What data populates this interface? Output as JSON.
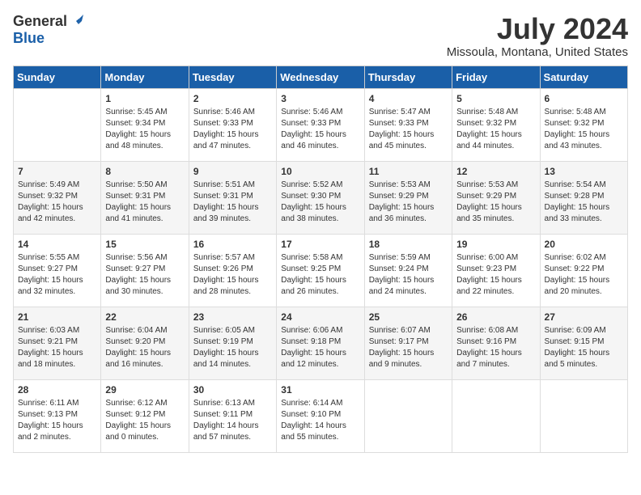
{
  "header": {
    "logo_general": "General",
    "logo_blue": "Blue",
    "title": "July 2024",
    "subtitle": "Missoula, Montana, United States"
  },
  "calendar": {
    "days_of_week": [
      "Sunday",
      "Monday",
      "Tuesday",
      "Wednesday",
      "Thursday",
      "Friday",
      "Saturday"
    ],
    "weeks": [
      [
        {
          "day": "",
          "info": ""
        },
        {
          "day": "1",
          "info": "Sunrise: 5:45 AM\nSunset: 9:34 PM\nDaylight: 15 hours\nand 48 minutes."
        },
        {
          "day": "2",
          "info": "Sunrise: 5:46 AM\nSunset: 9:33 PM\nDaylight: 15 hours\nand 47 minutes."
        },
        {
          "day": "3",
          "info": "Sunrise: 5:46 AM\nSunset: 9:33 PM\nDaylight: 15 hours\nand 46 minutes."
        },
        {
          "day": "4",
          "info": "Sunrise: 5:47 AM\nSunset: 9:33 PM\nDaylight: 15 hours\nand 45 minutes."
        },
        {
          "day": "5",
          "info": "Sunrise: 5:48 AM\nSunset: 9:32 PM\nDaylight: 15 hours\nand 44 minutes."
        },
        {
          "day": "6",
          "info": "Sunrise: 5:48 AM\nSunset: 9:32 PM\nDaylight: 15 hours\nand 43 minutes."
        }
      ],
      [
        {
          "day": "7",
          "info": "Sunrise: 5:49 AM\nSunset: 9:32 PM\nDaylight: 15 hours\nand 42 minutes."
        },
        {
          "day": "8",
          "info": "Sunrise: 5:50 AM\nSunset: 9:31 PM\nDaylight: 15 hours\nand 41 minutes."
        },
        {
          "day": "9",
          "info": "Sunrise: 5:51 AM\nSunset: 9:31 PM\nDaylight: 15 hours\nand 39 minutes."
        },
        {
          "day": "10",
          "info": "Sunrise: 5:52 AM\nSunset: 9:30 PM\nDaylight: 15 hours\nand 38 minutes."
        },
        {
          "day": "11",
          "info": "Sunrise: 5:53 AM\nSunset: 9:29 PM\nDaylight: 15 hours\nand 36 minutes."
        },
        {
          "day": "12",
          "info": "Sunrise: 5:53 AM\nSunset: 9:29 PM\nDaylight: 15 hours\nand 35 minutes."
        },
        {
          "day": "13",
          "info": "Sunrise: 5:54 AM\nSunset: 9:28 PM\nDaylight: 15 hours\nand 33 minutes."
        }
      ],
      [
        {
          "day": "14",
          "info": "Sunrise: 5:55 AM\nSunset: 9:27 PM\nDaylight: 15 hours\nand 32 minutes."
        },
        {
          "day": "15",
          "info": "Sunrise: 5:56 AM\nSunset: 9:27 PM\nDaylight: 15 hours\nand 30 minutes."
        },
        {
          "day": "16",
          "info": "Sunrise: 5:57 AM\nSunset: 9:26 PM\nDaylight: 15 hours\nand 28 minutes."
        },
        {
          "day": "17",
          "info": "Sunrise: 5:58 AM\nSunset: 9:25 PM\nDaylight: 15 hours\nand 26 minutes."
        },
        {
          "day": "18",
          "info": "Sunrise: 5:59 AM\nSunset: 9:24 PM\nDaylight: 15 hours\nand 24 minutes."
        },
        {
          "day": "19",
          "info": "Sunrise: 6:00 AM\nSunset: 9:23 PM\nDaylight: 15 hours\nand 22 minutes."
        },
        {
          "day": "20",
          "info": "Sunrise: 6:02 AM\nSunset: 9:22 PM\nDaylight: 15 hours\nand 20 minutes."
        }
      ],
      [
        {
          "day": "21",
          "info": "Sunrise: 6:03 AM\nSunset: 9:21 PM\nDaylight: 15 hours\nand 18 minutes."
        },
        {
          "day": "22",
          "info": "Sunrise: 6:04 AM\nSunset: 9:20 PM\nDaylight: 15 hours\nand 16 minutes."
        },
        {
          "day": "23",
          "info": "Sunrise: 6:05 AM\nSunset: 9:19 PM\nDaylight: 15 hours\nand 14 minutes."
        },
        {
          "day": "24",
          "info": "Sunrise: 6:06 AM\nSunset: 9:18 PM\nDaylight: 15 hours\nand 12 minutes."
        },
        {
          "day": "25",
          "info": "Sunrise: 6:07 AM\nSunset: 9:17 PM\nDaylight: 15 hours\nand 9 minutes."
        },
        {
          "day": "26",
          "info": "Sunrise: 6:08 AM\nSunset: 9:16 PM\nDaylight: 15 hours\nand 7 minutes."
        },
        {
          "day": "27",
          "info": "Sunrise: 6:09 AM\nSunset: 9:15 PM\nDaylight: 15 hours\nand 5 minutes."
        }
      ],
      [
        {
          "day": "28",
          "info": "Sunrise: 6:11 AM\nSunset: 9:13 PM\nDaylight: 15 hours\nand 2 minutes."
        },
        {
          "day": "29",
          "info": "Sunrise: 6:12 AM\nSunset: 9:12 PM\nDaylight: 15 hours\nand 0 minutes."
        },
        {
          "day": "30",
          "info": "Sunrise: 6:13 AM\nSunset: 9:11 PM\nDaylight: 14 hours\nand 57 minutes."
        },
        {
          "day": "31",
          "info": "Sunrise: 6:14 AM\nSunset: 9:10 PM\nDaylight: 14 hours\nand 55 minutes."
        },
        {
          "day": "",
          "info": ""
        },
        {
          "day": "",
          "info": ""
        },
        {
          "day": "",
          "info": ""
        }
      ]
    ]
  }
}
